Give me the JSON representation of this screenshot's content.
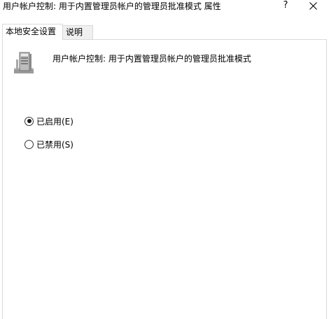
{
  "window": {
    "title": "用户帐户控制: 用于内置管理员帐户的管理员批准模式 属性",
    "help_label": "?"
  },
  "tabs": [
    {
      "label": "本地安全设置",
      "active": true
    },
    {
      "label": "说明",
      "active": false
    }
  ],
  "policy": {
    "icon": "computer-tower-icon",
    "name": "用户帐户控制: 用于内置管理员帐户的管理员批准模式"
  },
  "options": [
    {
      "label": "已启用(E)",
      "checked": true
    },
    {
      "label": "已禁用(S)",
      "checked": false
    }
  ]
}
